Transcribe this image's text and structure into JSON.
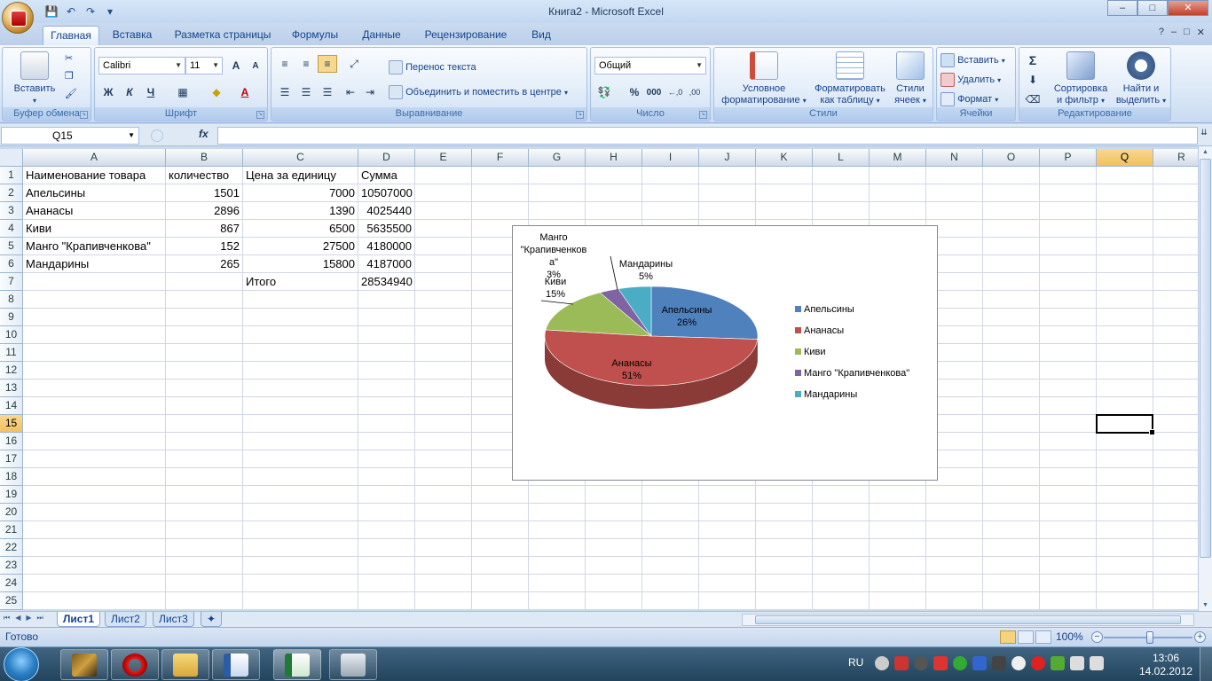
{
  "window": {
    "title": "Книга2 - Microsoft Excel",
    "minimize": "–",
    "maximize": "□",
    "close": "✕"
  },
  "ribbon_tabs": [
    "Главная",
    "Вставка",
    "Разметка страницы",
    "Формулы",
    "Данные",
    "Рецензирование",
    "Вид"
  ],
  "ribbon": {
    "clipboard": {
      "label": "Буфер обмена",
      "paste": "Вставить"
    },
    "font": {
      "label": "Шрифт",
      "name": "Calibri",
      "size": "11",
      "bold": "Ж",
      "italic": "К",
      "underline": "Ч",
      "grow": "A",
      "shrink": "A",
      "color": "A"
    },
    "alignment": {
      "label": "Выравнивание",
      "wrap": "Перенос текста",
      "merge": "Объединить и поместить в центре"
    },
    "number": {
      "label": "Число",
      "format": "Общий",
      "percent": "%",
      "thousands": "000"
    },
    "styles": {
      "label": "Стили",
      "conditional_1": "Условное",
      "conditional_2": "форматирование",
      "as_table_1": "Форматировать",
      "as_table_2": "как таблицу",
      "cell_styles_1": "Стили",
      "cell_styles_2": "ячеек"
    },
    "cells": {
      "label": "Ячейки",
      "insert": "Вставить",
      "delete": "Удалить",
      "format": "Формат"
    },
    "editing": {
      "label": "Редактирование",
      "sum": "Σ",
      "sort_1": "Сортировка",
      "sort_2": "и фильтр",
      "find_1": "Найти и",
      "find_2": "выделить"
    }
  },
  "formula_bar": {
    "name_box": "Q15",
    "fx": "fx",
    "value": ""
  },
  "columns": [
    "A",
    "B",
    "C",
    "D",
    "E",
    "F",
    "G",
    "H",
    "I",
    "J",
    "K",
    "L",
    "M",
    "N",
    "O",
    "P",
    "Q",
    "R"
  ],
  "rows": [
    "1",
    "2",
    "3",
    "4",
    "5",
    "6",
    "7",
    "8",
    "9",
    "10",
    "11",
    "12",
    "13",
    "14",
    "15",
    "16",
    "17",
    "18",
    "19",
    "20",
    "21",
    "22",
    "23",
    "24",
    "25"
  ],
  "selected": {
    "column": "Q",
    "row": "15"
  },
  "table": {
    "header": [
      "Наименование товара",
      "количество",
      "Цена за единицу",
      "Сумма"
    ],
    "rows": [
      [
        "Апельсины",
        "1501",
        "7000",
        "10507000"
      ],
      [
        "Ананасы",
        "2896",
        "1390",
        "4025440"
      ],
      [
        "Киви",
        "867",
        "6500",
        "5635500"
      ],
      [
        "Манго \"Крапивченкова\"",
        "152",
        "27500",
        "4180000"
      ],
      [
        "Мандарины",
        "265",
        "15800",
        "4187000"
      ]
    ],
    "total_label": "Итого",
    "total_value": "28534940"
  },
  "chart_data": {
    "type": "pie",
    "categories": [
      "Апельсины",
      "Ананасы",
      "Киви",
      "Манго \"Крапивченкова\"",
      "Мандарины"
    ],
    "values": [
      26,
      51,
      15,
      3,
      5
    ],
    "labels": [
      "Апельсины 26%",
      "Ананасы 51%",
      "Киви 15%",
      "Манго \"Крапивченкова\" 3%",
      "Мандарины 5%"
    ],
    "data_labels": {
      "oranges": [
        "Апельсины",
        "26%"
      ],
      "pineapples": [
        "Ананасы",
        "51%"
      ],
      "kiwi": [
        "Киви",
        "15%"
      ],
      "mango": [
        "Манго",
        "\"Крапивченков",
        "а\"",
        "3%"
      ],
      "mandarins": [
        "Мандарины",
        "5%"
      ]
    },
    "colors": [
      "#4f81bd",
      "#c0504d",
      "#9bbb59",
      "#8064a2",
      "#4bacc6"
    ],
    "legend_position": "right",
    "style": "3d"
  },
  "sheets": [
    "Лист1",
    "Лист2",
    "Лист3"
  ],
  "active_sheet": "Лист1",
  "status": {
    "ready": "Готово",
    "zoom": "100%"
  },
  "taskbar": {
    "lang": "RU",
    "time": "13:06",
    "date": "14.02.2012"
  }
}
